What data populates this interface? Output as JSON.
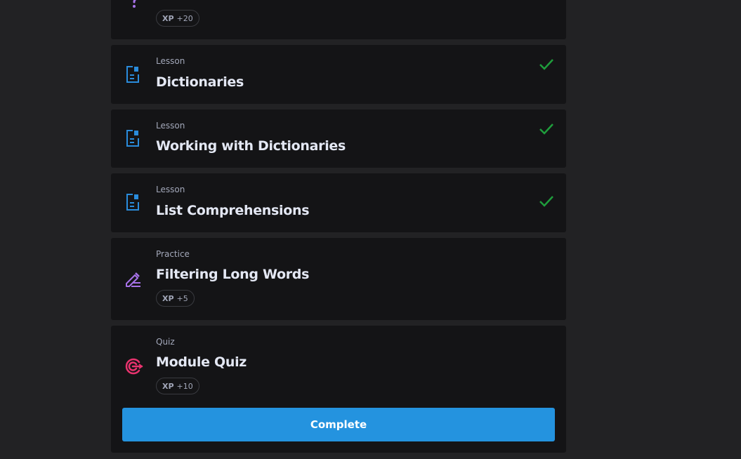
{
  "colors": {
    "background": "#222224",
    "card": "#141416",
    "lesson_icon": "#2a8cdc",
    "practice_icon": "#a772e8",
    "quiz_icon": "#e8336e",
    "check": "#1f9d3c",
    "button": "#2493df"
  },
  "top_card": {
    "icon": "question-mark-icon",
    "xp_label": "XP",
    "xp_value": "+20"
  },
  "items": [
    {
      "type": "Lesson",
      "title": "Dictionaries",
      "icon": "lesson-icon",
      "completed": true
    },
    {
      "type": "Lesson",
      "title": "Working with Dictionaries",
      "icon": "lesson-icon",
      "completed": true
    },
    {
      "type": "Lesson",
      "title": "List Comprehensions",
      "icon": "lesson-icon",
      "completed": true
    },
    {
      "type": "Practice",
      "title": "Filtering Long Words",
      "icon": "pencil-icon",
      "xp_label": "XP",
      "xp_value": "+5"
    },
    {
      "type": "Quiz",
      "title": "Module Quiz",
      "icon": "target-icon",
      "xp_label": "XP",
      "xp_value": "+10"
    }
  ],
  "complete_button_label": "Complete"
}
